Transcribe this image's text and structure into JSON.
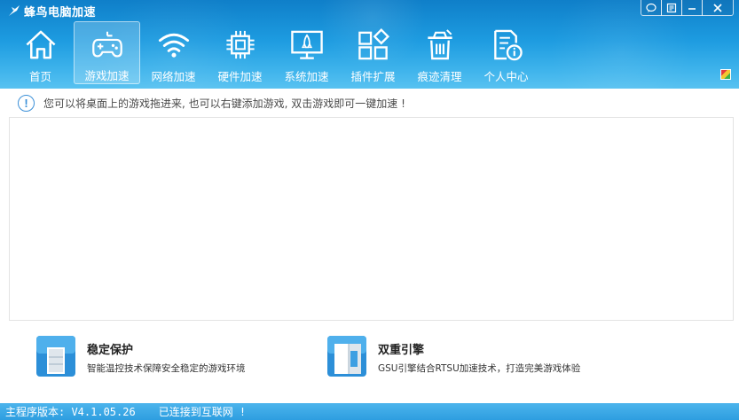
{
  "app": {
    "title": "蜂鸟电脑加速"
  },
  "window_controls": [
    {
      "name": "feedback-icon"
    },
    {
      "name": "menu-icon"
    },
    {
      "name": "minimize-icon"
    },
    {
      "name": "close-icon"
    }
  ],
  "nav": {
    "items": [
      {
        "label": "首页",
        "icon": "home-icon",
        "active": false
      },
      {
        "label": "游戏加速",
        "icon": "gamepad-icon",
        "active": true
      },
      {
        "label": "网络加速",
        "icon": "wifi-icon",
        "active": false
      },
      {
        "label": "硬件加速",
        "icon": "chip-icon",
        "active": false
      },
      {
        "label": "系统加速",
        "icon": "rocket-monitor-icon",
        "active": false
      },
      {
        "label": "插件扩展",
        "icon": "plugins-icon",
        "active": false
      },
      {
        "label": "痕迹清理",
        "icon": "trash-icon",
        "active": false
      },
      {
        "label": "个人中心",
        "icon": "user-doc-icon",
        "active": false
      }
    ]
  },
  "info": {
    "text": "您可以将桌面上的游戏拖进来, 也可以右键添加游戏, 双击游戏即可一键加速 !"
  },
  "features": [
    {
      "title": "稳定保护",
      "desc": "智能温控技术保障安全稳定的游戏环境"
    },
    {
      "title": "双重引擎",
      "desc": "GSU引擎结合RTSU加速技术，打造完美游戏体验"
    }
  ],
  "status": {
    "version": "主程序版本: V4.1.05.26",
    "connection": "已连接到互联网 !"
  },
  "colors": {
    "header": "#1d9be0",
    "accent": "#3a8fd8",
    "status_bar": "#2e9ee0"
  }
}
